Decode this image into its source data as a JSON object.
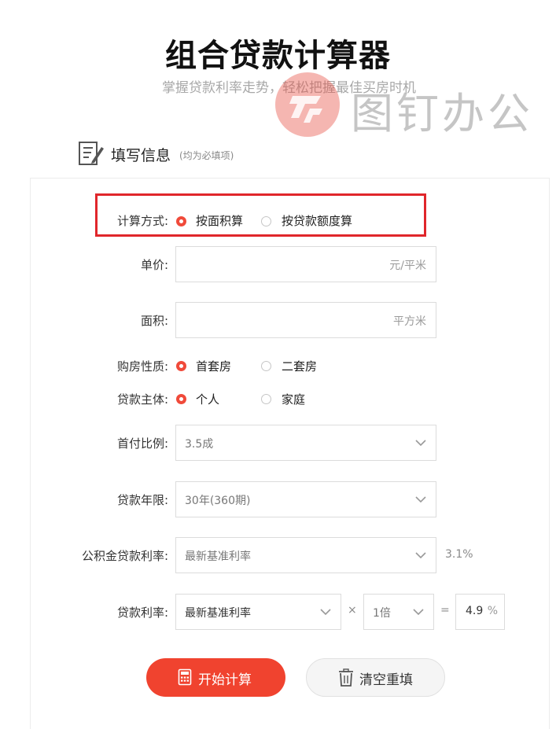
{
  "header": {
    "title": "组合贷款计算器",
    "subtitle": "掌握贷款利率走势，轻松把握最佳买房时机"
  },
  "watermark": {
    "text": "图钉办公"
  },
  "section": {
    "title": "填写信息",
    "note": "(均为必填项)"
  },
  "form": {
    "calc_method": {
      "label": "计算方式:",
      "options": [
        "按面积算",
        "按贷款额度算"
      ],
      "selected": 0
    },
    "unit_price": {
      "label": "单价:",
      "value": "",
      "placeholder_suffix": "元/平米"
    },
    "area": {
      "label": "面积:",
      "value": "",
      "placeholder_suffix": "平方米"
    },
    "purchase_type": {
      "label": "购房性质:",
      "options": [
        "首套房",
        "二套房"
      ],
      "selected": 0
    },
    "borrower": {
      "label": "贷款主体:",
      "options": [
        "个人",
        "家庭"
      ],
      "selected": 0
    },
    "down_payment": {
      "label": "首付比例:",
      "selected": "3.5成"
    },
    "loan_term": {
      "label": "贷款年限:",
      "selected": "30年(360期)"
    },
    "fund_rate": {
      "label": "公积金贷款利率:",
      "selected": "最新基准利率",
      "rate_text": "3.1%"
    },
    "loan_rate": {
      "label": "贷款利率:",
      "selected": "最新基准利率",
      "times_symbol": "×",
      "multiplier": "1倍",
      "equals_symbol": "=",
      "result_value": "4.9",
      "result_unit": "%"
    }
  },
  "buttons": {
    "calculate": "开始计算",
    "reset": "清空重填"
  },
  "colors": {
    "accent": "#f0432f",
    "highlight_border": "#e0262b",
    "radio_active": "#f04a3a"
  }
}
